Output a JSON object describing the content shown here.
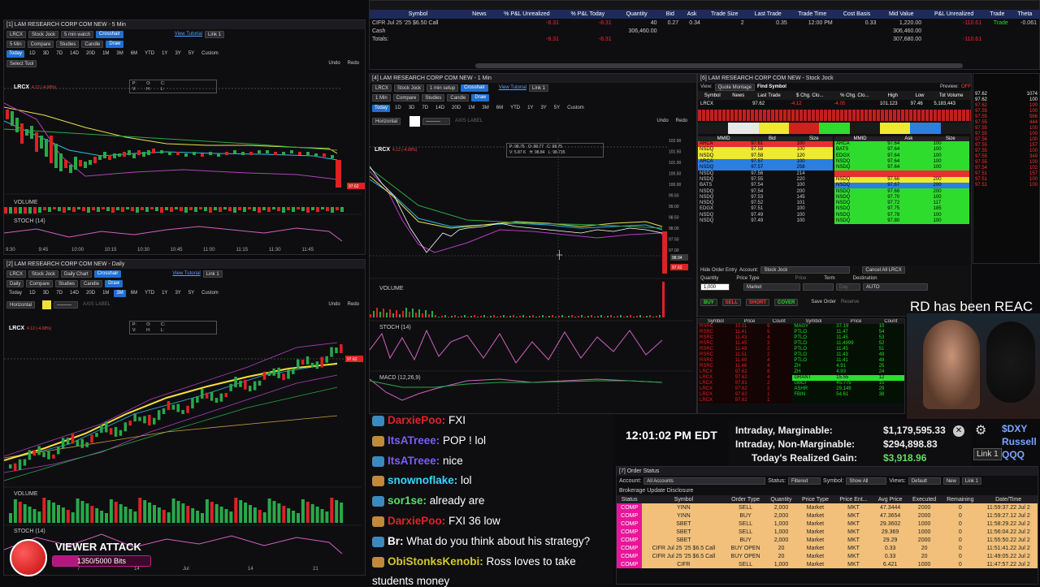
{
  "topWindow": {
    "headers": [
      "Symbol",
      "News",
      "% P&L Unrealized",
      "% P&L Today",
      "Quantity",
      "Bid",
      "Ask",
      "Trade Size",
      "Last Trade",
      "Trade Time",
      "Cost Basis",
      "Mid Value",
      "P&L Unrealized",
      "Trade",
      "Theta"
    ],
    "rows": [
      {
        "symbol": "CIFR Jul 25 '25 $6.50 Call",
        "unreal_pct": "-8.31",
        "today_pct": "-8.31",
        "qty": "40",
        "bid": "0.27",
        "ask": "0.34",
        "size": "2",
        "last": "0.35",
        "time": "12:00 PM",
        "basis": "0.33",
        "mid": "1,220.00",
        "pl": "-110.61",
        "trade": "Trade",
        "theta": "-0.061"
      },
      {
        "symbol": "Cash",
        "unreal_pct": "",
        "today_pct": "",
        "qty": "306,460.00",
        "bid": "",
        "ask": "",
        "size": "",
        "last": "",
        "time": "",
        "basis": "",
        "mid": "306,460.00",
        "pl": "",
        "trade": "",
        "theta": ""
      },
      {
        "symbol": "Totals:",
        "unreal_pct": "-8.31",
        "today_pct": "-8.31",
        "qty": "",
        "bid": "",
        "ask": "",
        "size": "",
        "last": "",
        "time": "",
        "basis": "",
        "mid": "307,680.00",
        "pl": "-110.61",
        "trade": "",
        "theta": ""
      }
    ]
  },
  "chart1": {
    "title": "[1] LAM RESEARCH CORP COM NEW - 5 Min",
    "period": "5 Min",
    "study": "Stock Jock",
    "setup": "5 min watch",
    "crosshair": "Crosshair",
    "tutorial": "View Tutorial",
    "link": "Link 1",
    "draw": "Draw",
    "compare": "Compare",
    "studies": "Studies",
    "candle": "Candle",
    "tool": "Select Tool",
    "undo": "Undo",
    "redo": "Redo",
    "symbol": "LRCX",
    "price": "97.62",
    "change": "4.12 (-4.08%)",
    "volume": "VOLUME",
    "stoch": "STOCH (14)",
    "times": [
      "9:30",
      "9:45",
      "10:00",
      "10:15",
      "10:30",
      "10:45",
      "11:00",
      "11:15",
      "11:30",
      "11:45"
    ],
    "ohlc": {
      "p": "P:",
      "o": "O:",
      "c": "C:",
      "v": "V:",
      "h": "H:",
      "l": "L:"
    }
  },
  "chart2": {
    "title": "[2] LAM RESEARCH CORP COM NEW - Daily",
    "period": "Daily",
    "study": "Stock Jock",
    "setup": "Daily Chart",
    "horizontal": "Horizontal",
    "axisLabel": "AXIS LABEL",
    "symbol": "LRCX",
    "price": "97.62",
    "change": "4.12 (-4.08%)",
    "volume": "VOLUME",
    "stoch": "STOCH (14)",
    "months": [
      "Jun",
      "7",
      "14",
      "Jul",
      "14",
      "21"
    ]
  },
  "chart4": {
    "title": "[4] LAM RESEARCH CORP COM NEW - 1 Min",
    "period": "1 Min",
    "study": "Stock Jock",
    "setup": "1 min setup",
    "symbol": "LRCX",
    "price": "97.62",
    "change": "4.12 (-4.08%)",
    "ohlcP": "P: 98.75",
    "ohlcO": "O: 98.77",
    "ohlcC": "C: 98.75",
    "ohlcV": "V: 5.87 K",
    "ohlcH": "H: 98.84",
    "ohlcL": "L: 98.735",
    "volume": "VOLUME",
    "stoch": "STOCH (14)",
    "macd": "MACD (12,26,9)",
    "yaxis": [
      "102.00",
      "101.50",
      "101.00",
      "100.50",
      "100.00",
      "99.50",
      "99.00",
      "98.50",
      "98.00",
      "97.50",
      "97.00"
    ],
    "priceTag": "97.62",
    "priceTag2": "98.04"
  },
  "timeframes": [
    "Today",
    "1D",
    "3D",
    "7D",
    "14D",
    "20D",
    "1M",
    "3M",
    "6M",
    "YTD",
    "1Y",
    "3Y",
    "5Y",
    "Custom"
  ],
  "timeframes4": [
    "Today",
    "1D",
    "3D",
    "7D",
    "14D",
    "20D",
    "1M",
    "3M",
    "6M",
    "YTD",
    "1Y",
    "3Y",
    "5Y",
    "Custom"
  ],
  "level2": {
    "title": "[6] LAM RESEARCH CORP COM NEW - Stock Jock",
    "view": "Quote Montage",
    "find": "Find Symbol",
    "preview": "Preview:",
    "previewState": "OFF",
    "qheaders": [
      "Symbol",
      "News",
      "Last Trade",
      "$ Chg. Clo...",
      "% Chg. Clo...",
      "High",
      "Low",
      "Tot Volume"
    ],
    "quote": {
      "symbol": "LRCX",
      "last": "97.62",
      "chg": "-4.12",
      "pct": "-4.05",
      "high": "101.123",
      "low": "97.46",
      "vol": "5,183,443"
    },
    "bidHdr": [
      "MMID",
      "Bid",
      "Size"
    ],
    "askHdr": [
      "MMID",
      "Ask",
      "Size"
    ],
    "bids": [
      [
        "ARCA",
        "97.61",
        "100"
      ],
      [
        "NSDQ",
        "97.58",
        "100"
      ],
      [
        "NSDQ",
        "97.58",
        "120"
      ],
      [
        "ARCA",
        "97.57",
        "100"
      ],
      [
        "NSDQ",
        "97.57",
        "258"
      ],
      [
        "NSDQ",
        "97.56",
        "214"
      ],
      [
        "NSDQ",
        "97.55",
        "220"
      ],
      [
        "BATS",
        "97.54",
        "100"
      ],
      [
        "NSDQ",
        "97.54",
        "200"
      ],
      [
        "NSDQ",
        "97.53",
        "145"
      ],
      [
        "NSDQ",
        "97.52",
        "101"
      ],
      [
        "EDGX",
        "97.51",
        "100"
      ],
      [
        "NSDQ",
        "97.49",
        "100"
      ],
      [
        "NSDQ",
        "97.49",
        "100"
      ]
    ],
    "asks": [
      [
        "ARCA",
        "97.64",
        "100"
      ],
      [
        "BATS",
        "97.64",
        "100"
      ],
      [
        "EDGX",
        "97.64",
        "100"
      ],
      [
        "NSDQ",
        "97.64",
        "100"
      ],
      [
        "NSDQ",
        "97.64",
        "100"
      ],
      [
        "",
        "",
        ""
      ],
      [
        "NSDQ",
        "97.66",
        "200"
      ],
      [
        "NSDQ",
        "97.67",
        "200"
      ],
      [
        "NSDQ",
        "97.68",
        "200"
      ],
      [
        "NSDQ",
        "97.70",
        "100"
      ],
      [
        "NSDQ",
        "97.72",
        "117"
      ],
      [
        "NSDQ",
        "97.75",
        "185"
      ],
      [
        "NSDQ",
        "97.78",
        "100"
      ],
      [
        "NSDQ",
        "97.80",
        "100"
      ]
    ],
    "tape": [
      "1074",
      "100",
      "100",
      "100",
      "566",
      "444",
      "100",
      "100",
      "100",
      "157",
      "100",
      "349",
      "100",
      "102",
      "157",
      "100",
      "100"
    ],
    "tapeP": [
      "97.62",
      "97.62",
      "97.62",
      "97.55",
      "97.55",
      "97.55",
      "97.55",
      "97.55",
      "97.56",
      "97.55",
      "97.55",
      "97.55",
      "97.55",
      "97.54",
      "97.51",
      "97.51",
      "97.51"
    ],
    "orderEntry": {
      "hide": "Hide Order Entry",
      "account": "Account:",
      "acctVal": "Stock Jock",
      "cancel": "Cancel All LRCX",
      "qty": "Quantity",
      "qtyVal": "1,000",
      "priceType": "Price Type",
      "ptVal": "Market",
      "price": "Price",
      "term": "Term",
      "termVal": "Day",
      "dest": "Destination",
      "destVal": "AUTO",
      "buy": "BUY",
      "sell": "SELL",
      "short": "SHORT",
      "cover": "COVER",
      "save": "Save Order",
      "reserve": "Reserve"
    }
  },
  "scanner": {
    "headers": [
      "Symbol",
      "Price",
      "Count",
      "Symbol",
      "Price",
      "Count"
    ],
    "left": [
      [
        "RSRC",
        "10.11",
        "6"
      ],
      [
        "RSRC",
        "11.41",
        "5"
      ],
      [
        "RSRC",
        "11.43",
        "4"
      ],
      [
        "RSRC",
        "11.45",
        "3"
      ],
      [
        "RSRC",
        "11.49",
        "2"
      ],
      [
        "RSRC",
        "11.51",
        "2"
      ],
      [
        "RSRC",
        "11.49",
        "4"
      ],
      [
        "RSRC",
        "11.46",
        "4"
      ],
      [
        "LRCX",
        "97.62",
        "8"
      ],
      [
        "LRCX",
        "97.62",
        "4"
      ],
      [
        "LRCX",
        "97.61",
        "2"
      ],
      [
        "LRCX",
        "97.62",
        "2"
      ],
      [
        "LRCX",
        "97.62",
        "1"
      ],
      [
        "LRCX",
        "97.62",
        "1"
      ]
    ],
    "right": [
      [
        "MAGY",
        "37.19",
        "10"
      ],
      [
        "PTLO",
        "11.47",
        "54"
      ],
      [
        "PTLO",
        "11.45",
        "53"
      ],
      [
        "PTLO",
        "11.4999",
        "52"
      ],
      [
        "PTLO",
        "11.45",
        "51"
      ],
      [
        "PTLO",
        "11.43",
        "49"
      ],
      [
        "PTLO",
        "11.41",
        "48"
      ],
      [
        "ZH",
        "4.91",
        "25"
      ],
      [
        "ZH",
        "4.93",
        "24"
      ],
      [
        "GRANT",
        "15.55",
        "12"
      ],
      [
        "GBCI",
        "45.775",
        "15"
      ],
      [
        "ASHR",
        "29.149",
        "29"
      ],
      [
        "FBIN",
        "54.61",
        "38"
      ],
      [
        "",
        "",
        ""
      ]
    ]
  },
  "overlay": {
    "ticker": "RD has been REAC"
  },
  "chat": [
    {
      "user": "DarxiePoo:",
      "msg": "FXI",
      "color": "#e0222a"
    },
    {
      "user": "ItsATreee:",
      "msg": "POP ! lol",
      "color": "#7b5cff"
    },
    {
      "user": "ItsATreee:",
      "msg": "nice",
      "color": "#7b5cff"
    },
    {
      "user": "snownoflake:",
      "msg": "lol",
      "color": "#37d4ff"
    },
    {
      "user": "sor1se:",
      "msg": "already are",
      "color": "#56e068"
    },
    {
      "user": "DarxiePoo:",
      "msg": "FXI 36 low",
      "color": "#e0222a"
    },
    {
      "user": "Br:",
      "msg": "What do you think about his strategy?",
      "color": "#ffffff"
    },
    {
      "user": "ObiStonksKenobi:",
      "msg": "Ross loves to take",
      "color": "#d4c82e"
    },
    {
      "user": "",
      "msg": "students money",
      "color": "#ffffff"
    }
  ],
  "viewer": {
    "label": "VIEWER ATTACK",
    "bits": "1350/5000 Bits"
  },
  "clock": "12:01:02 PM EDT",
  "account": {
    "m_label": "Intraday, Marginable:",
    "m_val": "$1,179,595.33",
    "nm_label": "Intraday, Non-Marginable:",
    "nm_val": "$294,898.83",
    "rg_label": "Today's Realized Gain:",
    "rg_val": "$3,918.96",
    "link": "Link 1"
  },
  "indices": [
    "$DXY",
    "Russell",
    "QQQ"
  ],
  "orders": {
    "title": "[7] Order Status",
    "account": "Account:",
    "acctVal": "All Accounts",
    "status": "Status:",
    "statusVal": "Filtered",
    "symbol": "Symbol:",
    "symbolVal": "Show All",
    "views": "Views:",
    "viewsVal": "Default",
    "newBtn": "New",
    "link": "Link 1",
    "disclosure": "Brokerage Update Disclosure",
    "headers": [
      "Status",
      "Symbol",
      "Order Type",
      "Quantity",
      "Price Type",
      "Price Ent...",
      "Avg Price",
      "Executed",
      "Remaining",
      "Date/Time"
    ],
    "rows": [
      [
        "COMP",
        "YINN",
        "SELL",
        "2,000",
        "Market",
        "MKT",
        "47.3444",
        "2000",
        "0",
        "11:59:37.22 Jul 2"
      ],
      [
        "COMP",
        "YINN",
        "BUY",
        "2,000",
        "Market",
        "MKT",
        "47.3654",
        "2000",
        "0",
        "11:59:27.12 Jul 2"
      ],
      [
        "COMP",
        "SBET",
        "SELL",
        "1,000",
        "Market",
        "MKT",
        "29.3602",
        "1000",
        "0",
        "11:58:29.22 Jul 2"
      ],
      [
        "COMP",
        "SBET",
        "SELL",
        "1,000",
        "Market",
        "MKT",
        "29.369",
        "1000",
        "0",
        "11:56:04.22 Jul 2"
      ],
      [
        "COMP",
        "SBET",
        "BUY",
        "2,000",
        "Market",
        "MKT",
        "29.29",
        "2000",
        "0",
        "11:55:50.22 Jul 2"
      ],
      [
        "COMP",
        "CIFR Jul 25 '25 $6.5 Call",
        "BUY OPEN",
        "20",
        "Market",
        "MKT",
        "0.33",
        "20",
        "0",
        "11:51:41.22 Jul 2"
      ],
      [
        "COMP",
        "CIFR Jul 25 '25 $6.5 Call",
        "BUY OPEN",
        "20",
        "Market",
        "MKT",
        "0.33",
        "20",
        "0",
        "11:49:05.22 Jul 2"
      ],
      [
        "COMP",
        "CIFR",
        "SELL",
        "1,000",
        "Market",
        "MKT",
        "6.421",
        "1000",
        "0",
        "11:47:57.22 Jul 2"
      ]
    ]
  }
}
